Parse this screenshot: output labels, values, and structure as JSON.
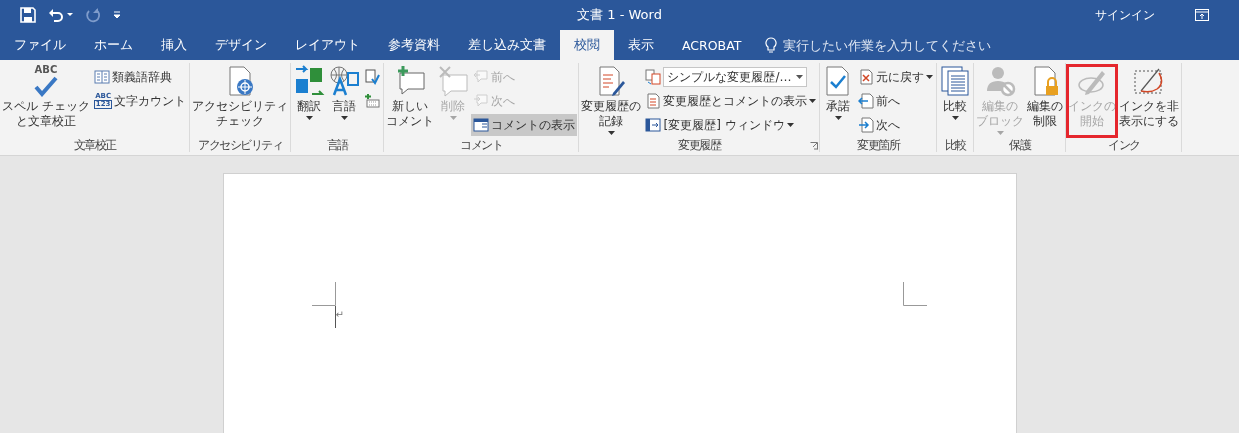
{
  "quick_access": [
    {
      "kind": "save"
    },
    {
      "kind": "undo",
      "disabled": false,
      "dropdown": true
    },
    {
      "kind": "redo",
      "disabled": true,
      "dropdown": false
    },
    {
      "kind": "customize"
    }
  ],
  "window": {
    "title": "文書 1  -  Word",
    "sign_in": "サインイン"
  },
  "tabs": [
    {
      "label": "ファイル",
      "selected": false
    },
    {
      "label": "ホーム",
      "selected": false
    },
    {
      "label": "挿入",
      "selected": false
    },
    {
      "label": "デザイン",
      "selected": false
    },
    {
      "label": "レイアウト",
      "selected": false
    },
    {
      "label": "参考資料",
      "selected": false
    },
    {
      "label": "差し込み文書",
      "selected": false
    },
    {
      "label": "校閲",
      "selected": true
    },
    {
      "label": "表示",
      "selected": false
    },
    {
      "label": "ACROBAT",
      "selected": false
    }
  ],
  "tell_me": {
    "placeholder": "実行したい作業を入力してください"
  },
  "ribbon": {
    "groups": [
      {
        "label": "文章校正",
        "launcher": false,
        "items": [
          {
            "kind": "large",
            "lines": [
              "スペル チェック",
              "と文章校正"
            ],
            "icon_text": "ABC",
            "disabled": false,
            "dropdown": false
          },
          {
            "kind": "small",
            "label": "類義語辞典",
            "disabled": false,
            "dropdown": false
          },
          {
            "kind": "small",
            "label": "文字カウント",
            "icon_text": "ABC",
            "icon_text_2": "123",
            "disabled": false,
            "dropdown": false
          }
        ]
      },
      {
        "label": "アクセシビリティ",
        "launcher": false,
        "items": [
          {
            "kind": "large",
            "lines": [
              "アクセシビリティ",
              "チェック"
            ],
            "disabled": false,
            "dropdown": false
          }
        ]
      },
      {
        "label": "言語",
        "launcher": false,
        "items": [
          {
            "kind": "large",
            "lines": [
              "翻訳"
            ],
            "disabled": false,
            "dropdown": true
          },
          {
            "kind": "large",
            "lines": [
              "言語"
            ],
            "disabled": false,
            "dropdown": true
          },
          {
            "kind": "small",
            "disabled": false,
            "dropdown": false
          },
          {
            "kind": "small",
            "disabled": false,
            "dropdown": false
          }
        ]
      },
      {
        "label": "コメント",
        "launcher": false,
        "items": [
          {
            "kind": "large",
            "lines": [
              "新しい",
              "コメント"
            ],
            "disabled": false,
            "dropdown": false,
            "pressed": false
          },
          {
            "kind": "large",
            "lines": [
              "削除"
            ],
            "disabled": true,
            "dropdown": true,
            "pressed": false
          },
          {
            "kind": "small",
            "label": "前へ",
            "disabled": true,
            "dropdown": false,
            "pressed": false
          },
          {
            "kind": "small",
            "label": "次へ",
            "disabled": true,
            "dropdown": false,
            "pressed": false
          },
          {
            "kind": "small",
            "label": "コメントの表示",
            "disabled": false,
            "dropdown": false,
            "pressed": true
          }
        ]
      },
      {
        "label": "変更履歴",
        "launcher": true,
        "items": [
          {
            "kind": "large",
            "lines": [
              "変更履歴の",
              "記録"
            ],
            "disabled": false,
            "dropdown": true
          },
          {
            "kind": "combo",
            "value": "シンプルな変更履歴/…",
            "disabled": false,
            "dropdown": true
          },
          {
            "kind": "small",
            "label": "変更履歴とコメントの表示",
            "disabled": false,
            "dropdown": true
          },
          {
            "kind": "small",
            "label": "[変更履歴] ウィンドウ",
            "disabled": false,
            "dropdown": true
          }
        ]
      },
      {
        "label": "変更箇所",
        "launcher": false,
        "items": [
          {
            "kind": "large",
            "lines": [
              "承諾"
            ],
            "disabled": false,
            "dropdown": true
          },
          {
            "kind": "small",
            "label": "元に戻す",
            "disabled": false,
            "dropdown": true
          },
          {
            "kind": "small",
            "label": "前へ",
            "disabled": false,
            "dropdown": false
          },
          {
            "kind": "small",
            "label": "次へ",
            "disabled": false,
            "dropdown": false
          }
        ]
      },
      {
        "label": "比較",
        "launcher": false,
        "items": [
          {
            "kind": "large",
            "lines": [
              "比較"
            ],
            "disabled": false,
            "dropdown": true
          }
        ]
      },
      {
        "label": "保護",
        "launcher": false,
        "items": [
          {
            "kind": "large",
            "lines": [
              "編集の",
              "ブロック"
            ],
            "disabled": true,
            "dropdown": true
          },
          {
            "kind": "large",
            "lines": [
              "編集の",
              "制限"
            ],
            "disabled": false,
            "dropdown": false
          }
        ]
      },
      {
        "label": "インク",
        "launcher": false,
        "items": [
          {
            "kind": "large",
            "lines": [
              "インクの",
              "開始"
            ],
            "disabled": true,
            "dropdown": false,
            "outlined": true
          },
          {
            "kind": "large",
            "lines": [
              "インクを非",
              "表示にする"
            ],
            "disabled": false,
            "dropdown": false,
            "outlined": false
          }
        ]
      }
    ]
  },
  "document": {
    "paragraph_mark": "↵"
  }
}
